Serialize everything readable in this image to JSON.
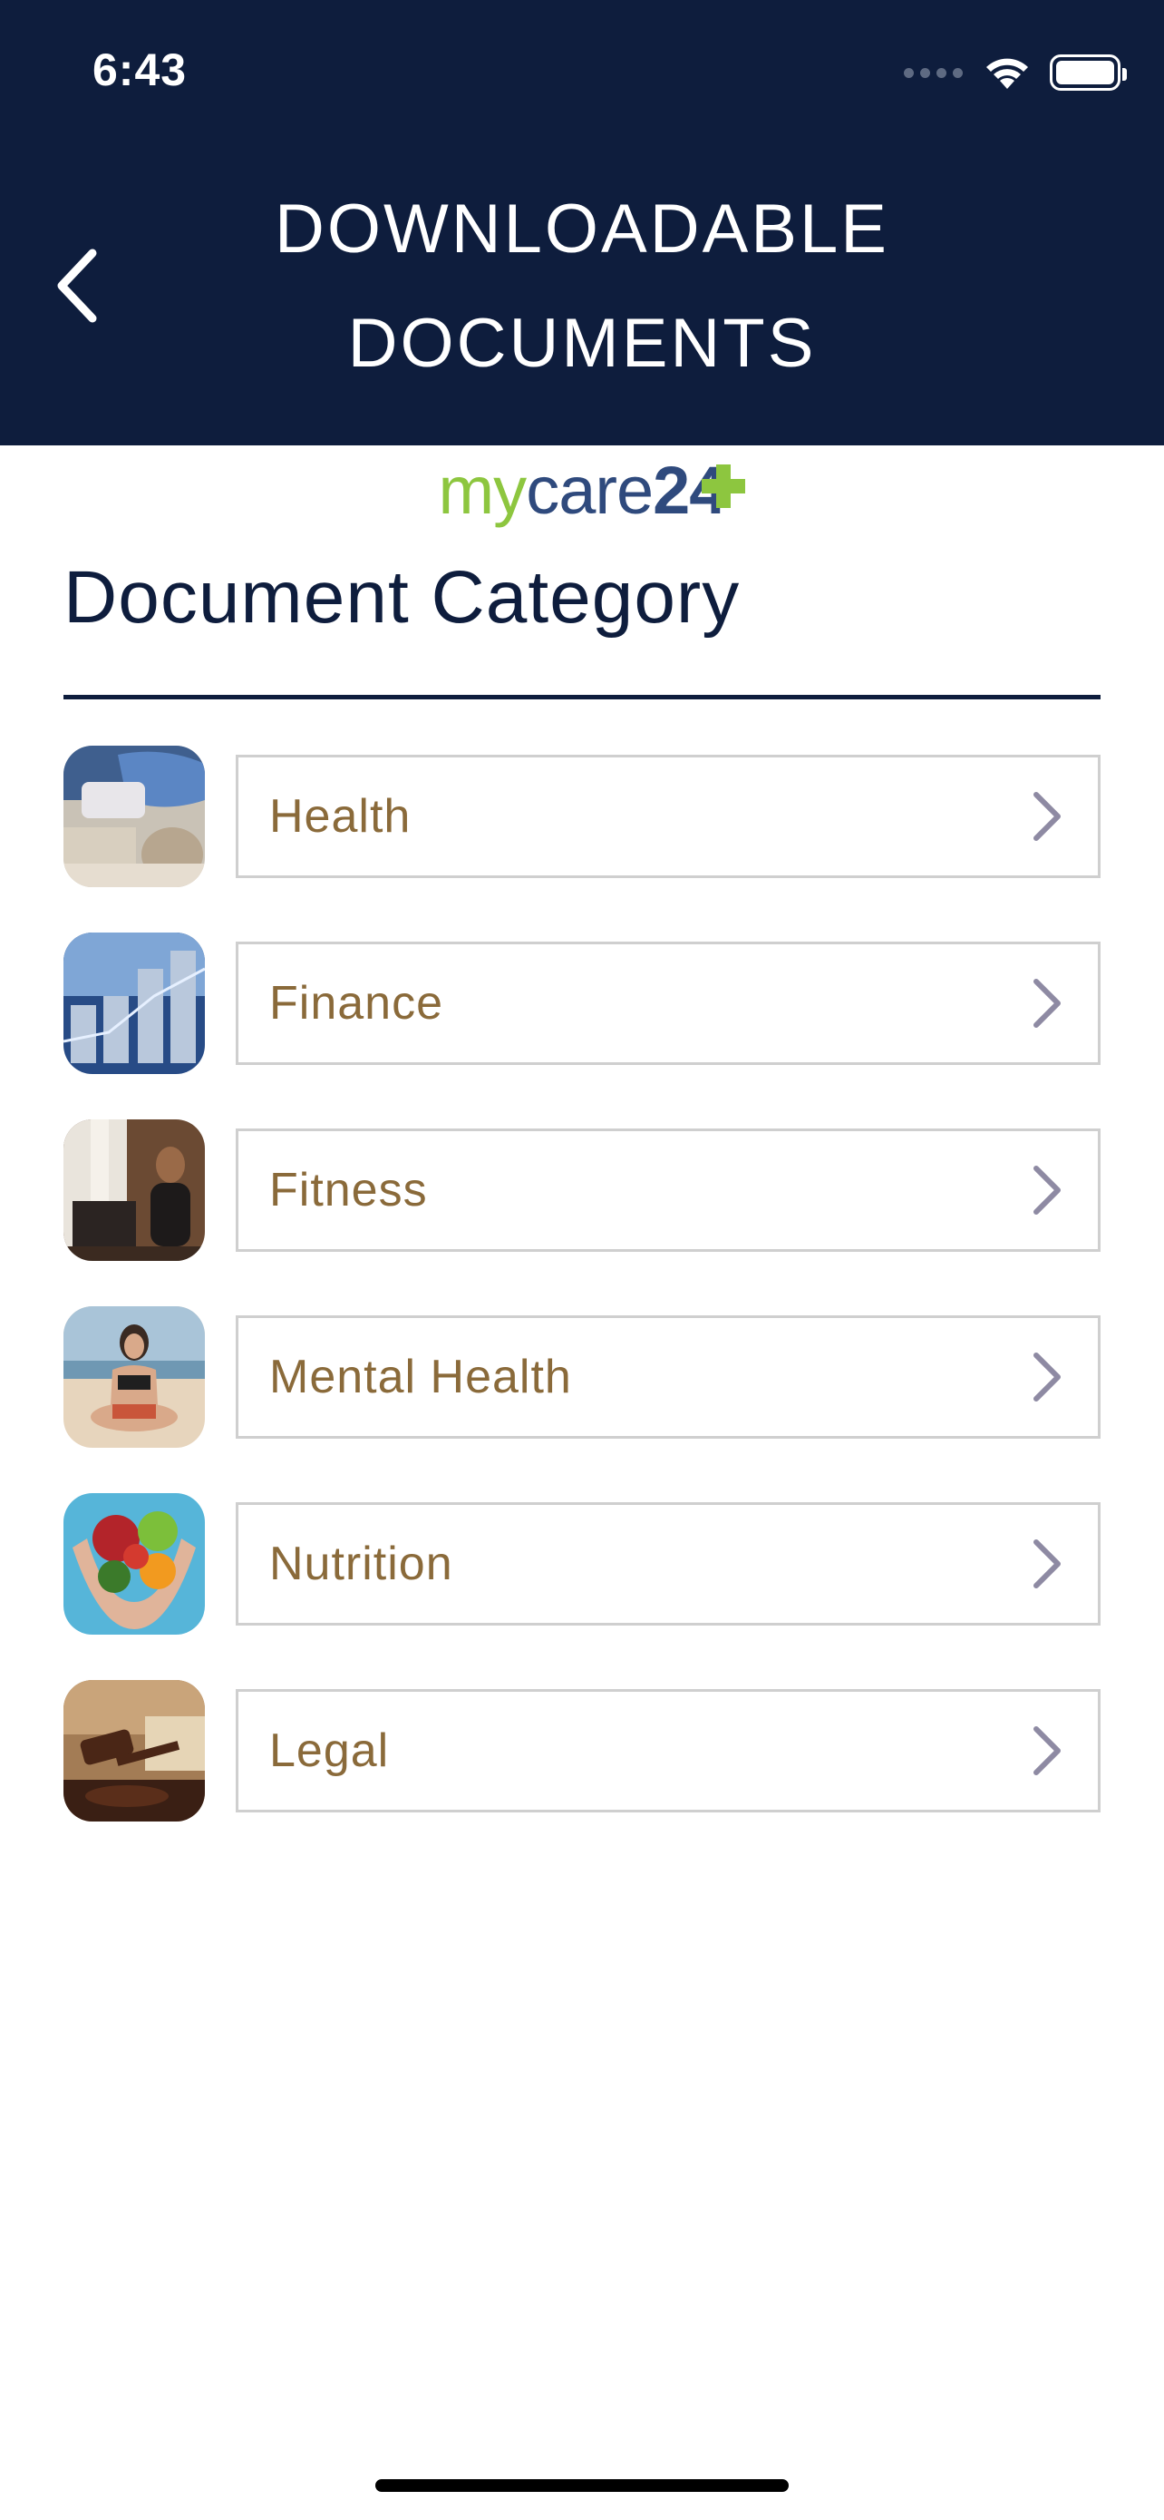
{
  "status_bar": {
    "time": "6:43"
  },
  "header": {
    "title": "DOWNLOADABLE DOCUMENTS"
  },
  "logo": {
    "part1": "my",
    "part2": "care",
    "part3": "24"
  },
  "section": {
    "title": "Document Category"
  },
  "categories": [
    {
      "label": "Health",
      "image": "health-photo"
    },
    {
      "label": "Finance",
      "image": "finance-photo"
    },
    {
      "label": "Fitness",
      "image": "fitness-photo"
    },
    {
      "label": "Mental Health",
      "image": "mental-health-photo"
    },
    {
      "label": "Nutrition",
      "image": "nutrition-photo"
    },
    {
      "label": "Legal",
      "image": "legal-photo"
    }
  ],
  "colors": {
    "header_bg": "#0e1d3d",
    "label_text": "#8a6a3a",
    "logo_green": "#8dc63f",
    "logo_blue": "#2f4a7d",
    "chevron": "#8e8aa3"
  }
}
